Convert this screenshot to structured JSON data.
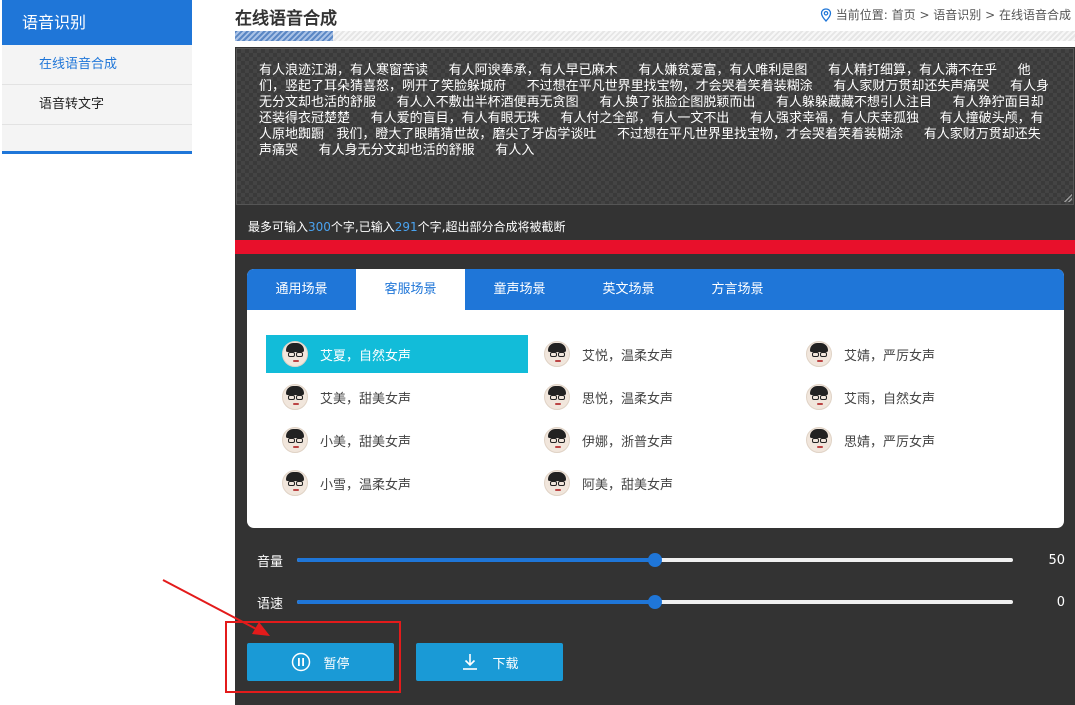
{
  "sidebar": {
    "heading": "语音识别",
    "items": [
      {
        "label": "在线语音合成",
        "active": true
      },
      {
        "label": "语音转文字",
        "active": false
      }
    ]
  },
  "header": {
    "title": "在线语音合成",
    "breadcrumb": "当前位置: 首页 > 语音识别 > 在线语音合成"
  },
  "editor": {
    "text": "有人浪迹江湖，有人寒窗苦读     有人阿谀奉承，有人早已麻木     有人嫌贫爱富，有人唯利是图     有人精打细算，有人满不在乎     他们，竖起了耳朵猜喜怒，咧开了笑脸躲城府     不过想在平凡世界里找宝物，才会哭着笑着装糊涂     有人家财万贯却还失声痛哭     有人身无分文却也活的舒服     有人入不敷出半杯酒便再无贪图     有人换了张脸企图脱颖而出     有人躲躲藏藏不想引人注目     有人狰狞面目却还装得衣冠楚楚     有人爱的盲目，有人有眼无珠     有人付之全部，有人一文不出     有人强求幸福，有人庆幸孤独     有人撞破头颅，有人原地踟蹰   我们，瞪大了眼睛猜世故，磨尖了牙齿学谈吐     不过想在平凡世界里找宝物，才会哭着笑着装糊涂     有人家财万贯却还失声痛哭     有人身无分文却也活的舒服     有人入",
    "hint_prefix": "最多可输入",
    "max_chars": "300",
    "hint_mid": "个字,已输入",
    "entered_chars": "291",
    "hint_suffix": "个字,超出部分合成将被截断"
  },
  "scenes": {
    "tabs": [
      "通用场景",
      "客服场景",
      "童声场景",
      "英文场景",
      "方言场景"
    ],
    "active_tab": "客服场景",
    "voices": [
      {
        "label": "艾夏，自然女声",
        "selected": true
      },
      {
        "label": "艾悦，温柔女声",
        "selected": false
      },
      {
        "label": "艾婧，严厉女声",
        "selected": false
      },
      {
        "label": "艾美，甜美女声",
        "selected": false
      },
      {
        "label": "思悦，温柔女声",
        "selected": false
      },
      {
        "label": "艾雨，自然女声",
        "selected": false
      },
      {
        "label": "小美，甜美女声",
        "selected": false
      },
      {
        "label": "伊娜，浙普女声",
        "selected": false
      },
      {
        "label": "思婧，严厉女声",
        "selected": false
      },
      {
        "label": "小雪，温柔女声",
        "selected": false
      },
      {
        "label": "阿美，甜美女声",
        "selected": false
      }
    ]
  },
  "controls": {
    "volume": {
      "label": "音量",
      "value": "50",
      "level": 0.5
    },
    "speed": {
      "label": "语速",
      "value": "0",
      "level": 0.5
    }
  },
  "buttons": {
    "pause": "暂停",
    "download": "下载"
  },
  "colors": {
    "primary": "#1f76d8",
    "selected_voice": "#12bcd9",
    "warning_bar": "#e8102b",
    "button": "#1a9ad6",
    "annotation": "#e31b1b"
  }
}
